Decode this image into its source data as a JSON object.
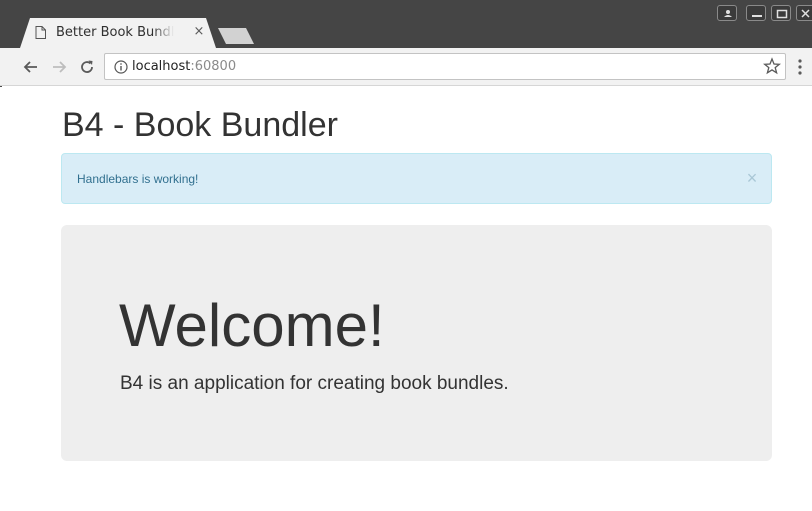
{
  "browser": {
    "tab_title": "Better Book Bundler",
    "tab_close": "×",
    "url_host": "localhost",
    "url_port": ":60800"
  },
  "page": {
    "title": "B4 - Book Bundler",
    "alert": {
      "message": "Handlebars is working!",
      "close": "×"
    },
    "jumbotron": {
      "heading": "Welcome!",
      "lead": "B4 is an application for creating book bundles."
    }
  },
  "colors": {
    "alert_background": "#d9edf7",
    "alert_text": "#31708f",
    "jumbotron_background": "#eeeeee",
    "text": "#333333"
  }
}
